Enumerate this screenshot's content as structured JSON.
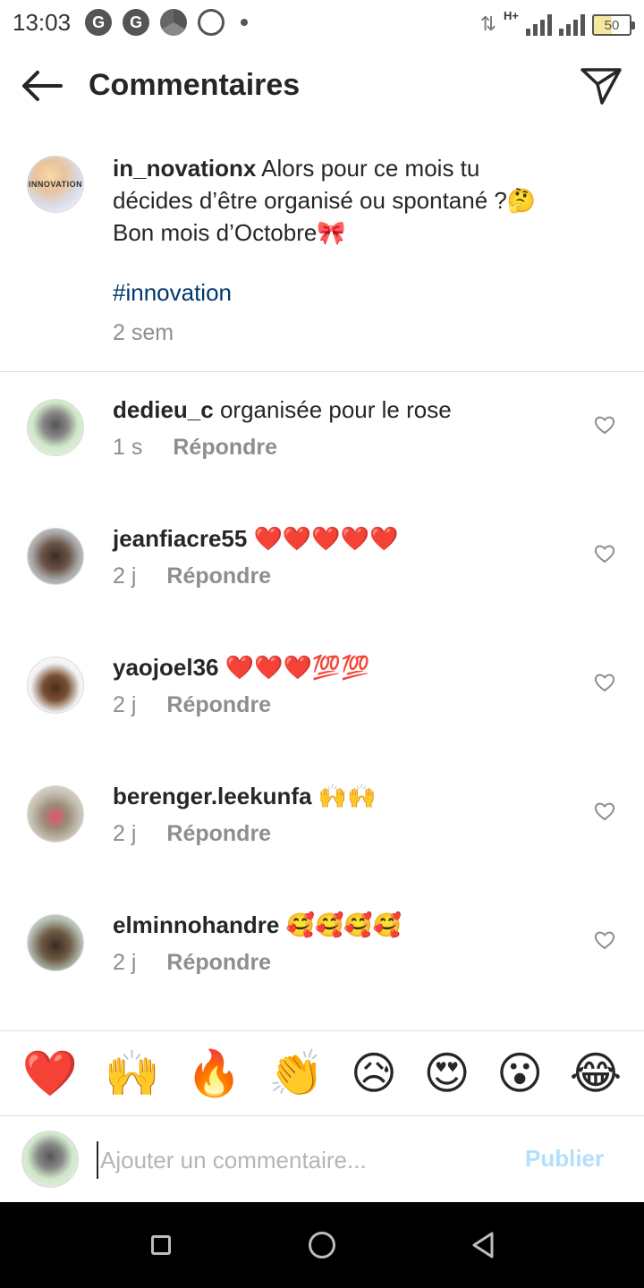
{
  "status_bar": {
    "time": "13:03",
    "notif_icons": [
      "G",
      "G"
    ],
    "icon_names": [
      "google-icon",
      "google-icon",
      "chrome-icon",
      "whatsapp-icon"
    ],
    "network": "H+",
    "battery": "50"
  },
  "header": {
    "title": "Commentaires"
  },
  "caption": {
    "username": "in_novationx",
    "line1": "Alors pour ce mois tu",
    "line2": "décides d’être organisé ou spontané ?🤔",
    "line3": "Bon mois d’Octobre🎀",
    "hashtag": "#innovation",
    "time": "2 sem",
    "avatar_logo": "INNOVATION"
  },
  "comments": [
    {
      "username": "dedieu_c",
      "text": "organisée pour le rose",
      "time": "1 s",
      "reply": "Répondre"
    },
    {
      "username": "jeanfiacre55",
      "text": "❤️❤️❤️❤️❤️",
      "time": "2 j",
      "reply": "Répondre"
    },
    {
      "username": "yaojoel36",
      "text": "❤️❤️❤️💯💯",
      "time": "2 j",
      "reply": "Répondre"
    },
    {
      "username": "berenger.leekunfa",
      "text": "🙌🙌",
      "time": "2 j",
      "reply": "Répondre"
    },
    {
      "username": "elminnohandre",
      "text": "🥰🥰🥰🥰",
      "time": "2 j",
      "reply": "Répondre"
    }
  ],
  "emoji_bar": [
    "❤️",
    "🙌",
    "🔥",
    "👏",
    "😥",
    "😍",
    "😮",
    "😂"
  ],
  "input": {
    "placeholder": "Ajouter un commentaire...",
    "publish": "Publier"
  },
  "colors": {
    "hashtag": "#00376b",
    "meta": "#8e8e8e",
    "publish_disabled": "#b2dffc",
    "divider": "#dbdbdb"
  }
}
